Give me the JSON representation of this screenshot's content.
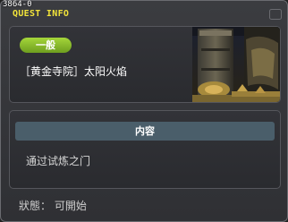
{
  "window": {
    "code": "3864-0",
    "title": "QUEST INFO"
  },
  "quest": {
    "tag": "一般",
    "name": "［黄金寺院］太阳火焰"
  },
  "content": {
    "header": "内容",
    "text": "通过试炼之门"
  },
  "status": {
    "text": "狀態： 可開始"
  },
  "colors": {
    "title": "#f2e43a",
    "tag_bg": "#8bbd2a",
    "content_header_bg": "#4a5e6a"
  }
}
